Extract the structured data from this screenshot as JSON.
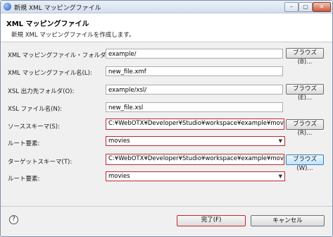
{
  "window": {
    "title": "新規 XML マッピングファイル",
    "controls": {
      "minimize": "–",
      "maximize": "▢",
      "close": "✕"
    }
  },
  "banner": {
    "title": "XML マッピングファイル",
    "description": "新規 XML マッピングファイルを作成します。"
  },
  "form": {
    "rows": [
      {
        "label": "XML マッピングファイル・フォルダ(M):",
        "value": "example/",
        "browse": "ブラウズ(B)..."
      },
      {
        "label": "XML マッピングファイル名(L):",
        "value": "new_file.xmf"
      },
      {
        "label": "XSL 出力先フォルダ(O):",
        "value": "example/xsl/",
        "browse": "ブラウズ(E)..."
      },
      {
        "label": "XSL ファイル名(N):",
        "value": "new_file.xsl"
      },
      {
        "label": "ソーススキーマ(S):",
        "value": "C:¥WebOTX¥Developer¥Studio¥workspace¥example¥movielist.xsd",
        "browse": "ブラウズ(R)..."
      },
      {
        "label": "ルート要素:",
        "value": "movies"
      },
      {
        "label": "ターゲットスキーマ(T):",
        "value": "C:¥WebOTX¥Developer¥Studio¥workspace¥example¥moviecount.xsd",
        "browse": "ブラウズ(W)..."
      },
      {
        "label": "ルート要素:",
        "value": "movies"
      }
    ]
  },
  "footer": {
    "help_icon": "?",
    "finish": "完了(F)",
    "cancel": "キャンセル"
  }
}
